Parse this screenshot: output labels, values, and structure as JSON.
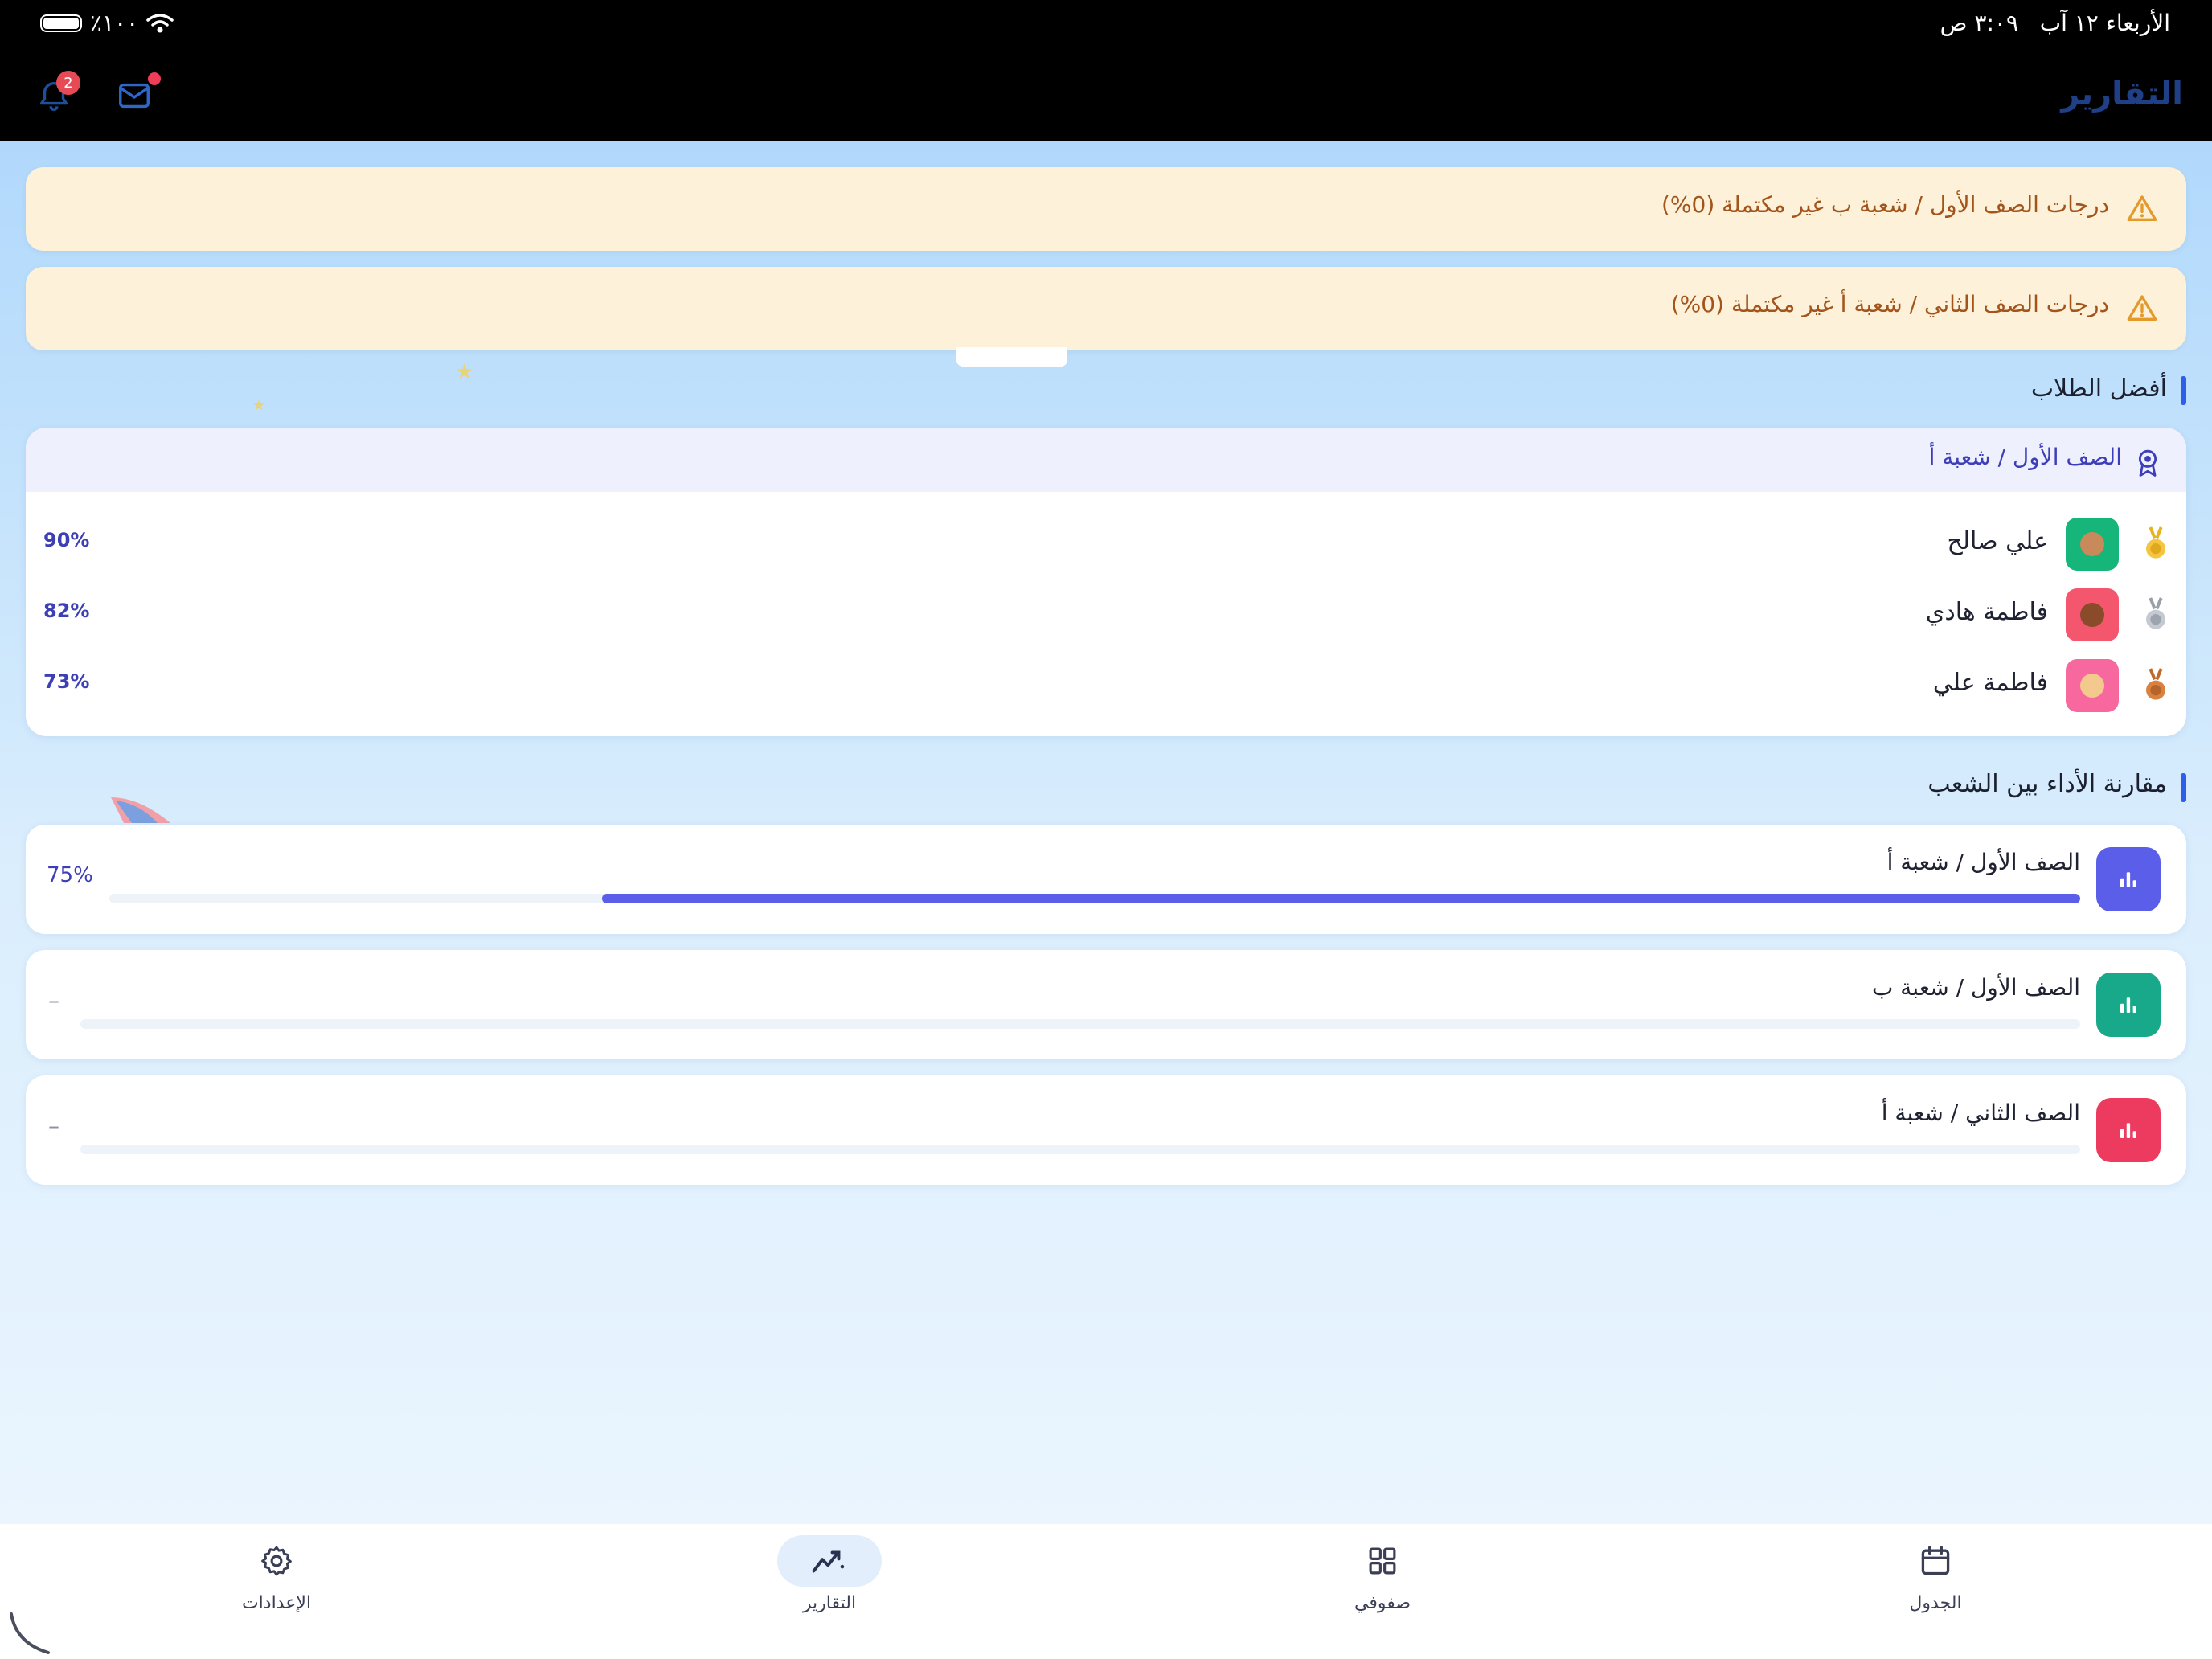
{
  "status_bar": {
    "time": "٣:٠٩ ص",
    "date": "الأربعاء ١٢ آب",
    "battery": "٪١٠٠"
  },
  "header": {
    "title": "التقارير",
    "notification_count": "2",
    "notification_icon": "bell-icon",
    "mail_icon": "mail-icon"
  },
  "alerts": [
    {
      "text": "درجات الصف الأول / شعبة ب غير مكتملة (0%)",
      "icon": "warning-icon"
    },
    {
      "text": "درجات الصف الثاني / شعبة أ غير مكتملة (0%)",
      "icon": "warning-icon"
    }
  ],
  "top_students": {
    "title": "أفضل الطلاب",
    "class_label": "الصف الأول / شعبة أ",
    "students": [
      {
        "name": "علي صالح",
        "score": "90%",
        "medal": "gold-medal-icon",
        "avatar_color": "#16b57a"
      },
      {
        "name": "فاطمة هادي",
        "score": "82%",
        "medal": "silver-medal-icon",
        "avatar_color": "#f4566d"
      },
      {
        "name": "فاطمة علي",
        "score": "73%",
        "medal": "bronze-medal-icon",
        "avatar_color": "#f7689f"
      }
    ]
  },
  "comparison": {
    "title": "مقارنة الأداء بين الشعب",
    "items": [
      {
        "name": "الصف الأول / شعبة أ",
        "value": "75%",
        "progress": 0.75,
        "color": "#5b5ee8"
      },
      {
        "name": "الصف الأول / شعبة ب",
        "value": "–",
        "progress": 0,
        "color": "#18a98a"
      },
      {
        "name": "الصف الثاني / شعبة أ",
        "value": "–",
        "progress": 0,
        "color": "#ec3b5e"
      }
    ]
  },
  "bottom_nav": {
    "items": [
      {
        "label": "الإعدادات",
        "icon": "gear-icon"
      },
      {
        "label": "التقارير",
        "icon": "chart-trend-icon",
        "active": true
      },
      {
        "label": "صفوفي",
        "icon": "grid-icon"
      },
      {
        "label": "الجدول",
        "icon": "calendar-icon"
      }
    ]
  }
}
